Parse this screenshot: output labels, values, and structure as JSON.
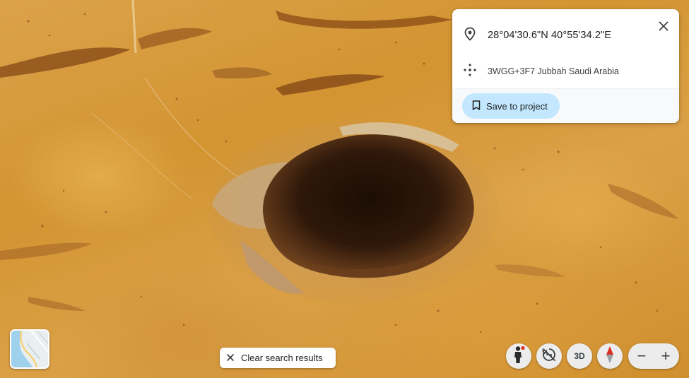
{
  "location_card": {
    "coordinates": "28°04'30.6\"N 40°55'34.2\"E",
    "plus_code": "3WGG+3F7 Jubbah Saudi Arabia",
    "save_label": "Save to project",
    "icons": {
      "pin": "location-pin-icon",
      "plus_code": "plus-code-icon",
      "close": "close-icon",
      "bookmark": "bookmark-icon"
    }
  },
  "search": {
    "clear_label": "Clear search results"
  },
  "controls": {
    "three_d_label": "3D",
    "zoom_out_label": "−",
    "zoom_in_label": "+"
  },
  "colors": {
    "save_button_bg": "#c2e7ff",
    "compass_red": "#d93025",
    "sand": "#d79a3a",
    "crater": "#2a1608"
  }
}
